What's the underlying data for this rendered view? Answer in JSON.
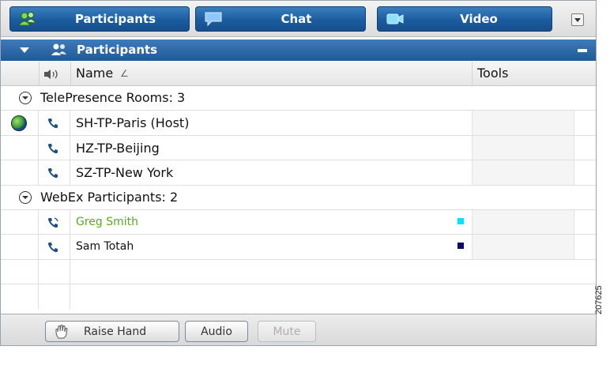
{
  "tabs": [
    {
      "label": "Participants",
      "icon": "participants-icon"
    },
    {
      "label": "Chat",
      "icon": "chat-bubble-icon"
    },
    {
      "label": "Video",
      "icon": "video-camera-icon"
    }
  ],
  "section": {
    "title": "Participants"
  },
  "columns": {
    "name": "Name",
    "sort_glyph": "∠",
    "tools": "Tools"
  },
  "groups": [
    {
      "label": "TelePresence Rooms: 3",
      "rows": [
        {
          "name": "SH-TP-Paris (Host)",
          "status_icon": "globe-icon",
          "audio_icon": "phone-icon"
        },
        {
          "name": "HZ-TP-Beijing",
          "audio_icon": "phone-icon"
        },
        {
          "name": "SZ-TP-New York",
          "audio_icon": "phone-icon"
        }
      ]
    },
    {
      "label": "WebEx Participants: 2",
      "rows": [
        {
          "name": "Greg Smith",
          "audio_icon": "phone-speaking-icon",
          "color_marker": "#00e5ff",
          "name_color": "#5aaa1e"
        },
        {
          "name": "Sam Totah",
          "audio_icon": "phone-icon",
          "color_marker": "#0a0a6e"
        }
      ]
    }
  ],
  "footer": {
    "raise_hand": "Raise Hand",
    "audio": "Audio",
    "mute": "Mute"
  },
  "figure_number": "207625",
  "colors": {
    "tab_blue": "#1b5c9f",
    "header_blue": "#2a66a6"
  }
}
